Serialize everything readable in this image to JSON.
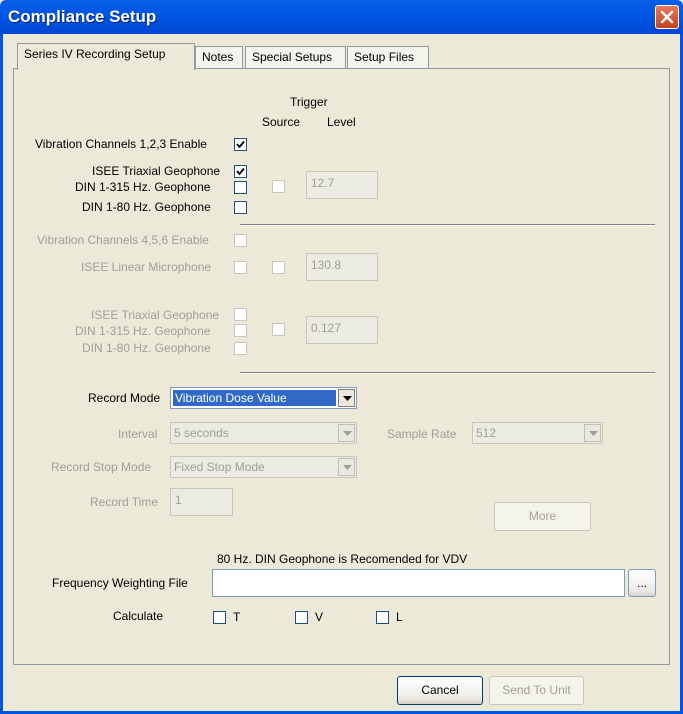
{
  "window": {
    "title": "Compliance Setup"
  },
  "tabs": [
    {
      "label": "Series IV Recording Setup"
    },
    {
      "label": "Notes"
    },
    {
      "label": "Special Setups"
    },
    {
      "label": "Setup Files"
    }
  ],
  "trigger": {
    "header": "Trigger",
    "source": "Source",
    "level": "Level"
  },
  "vib123": {
    "enable_label": "Vibration Channels 1,2,3 Enable",
    "enable_checked": true,
    "isee_label": "ISEE Triaxial Geophone",
    "isee_checked": true,
    "din315_label": "DIN 1-315 Hz. Geophone",
    "din80_label": "DIN 1-80 Hz. Geophone",
    "trigger_level": "12.7"
  },
  "vib456": {
    "enable_label": "Vibration Channels 4,5,6 Enable",
    "mic_label": "ISEE Linear Microphone",
    "mic_level": "130.8",
    "isee_label": "ISEE Triaxial Geophone",
    "din315_label": "DIN 1-315 Hz. Geophone",
    "din80_label": "DIN 1-80 Hz. Geophone",
    "trigger_level": "0.127"
  },
  "record": {
    "mode_label": "Record Mode",
    "mode_value": "Vibration Dose Value",
    "interval_label": "Interval",
    "interval_value": "5 seconds",
    "sample_rate_label": "Sample Rate",
    "sample_rate_value": "512",
    "stop_mode_label": "Record Stop Mode",
    "stop_mode_value": "Fixed Stop Mode",
    "time_label": "Record Time",
    "time_value": "1",
    "more_label": "More"
  },
  "note": "80 Hz. DIN Geophone is Recomended for VDV",
  "freq": {
    "label": "Frequency Weighting File",
    "value": "",
    "browse_label": "..."
  },
  "calculate": {
    "label": "Calculate",
    "t": "T",
    "v": "V",
    "l": "L"
  },
  "buttons": {
    "cancel": "Cancel",
    "send": "Send To Unit"
  },
  "colors": {
    "titlebar": "#0055E5",
    "face": "#ECE9D8",
    "selection": "#316AC5",
    "disabled_text": "#A19F96"
  }
}
